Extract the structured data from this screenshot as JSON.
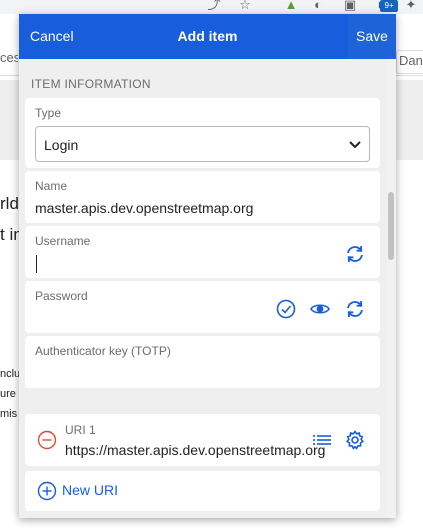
{
  "background_page": {
    "bookmark_left_text": "ces",
    "bookmark_right_text": "Dan",
    "extension_badge": "9+",
    "fragments": [
      "rld",
      "t in",
      "nclu",
      "ure",
      "mis"
    ]
  },
  "header": {
    "cancel_label": "Cancel",
    "title": "Add item",
    "save_label": "Save"
  },
  "section": {
    "title": "ITEM INFORMATION"
  },
  "fields": {
    "type_label": "Type",
    "type_value": "Login",
    "name_label": "Name",
    "name_value": "master.apis.dev.openstreetmap.org",
    "username_label": "Username",
    "username_value": "",
    "password_label": "Password",
    "password_value": "",
    "totp_label": "Authenticator key (TOTP)",
    "totp_value": ""
  },
  "uri": {
    "label": "URI 1",
    "value": "https://master.apis.dev.openstreetmap.org",
    "new_uri_label": "New URI"
  },
  "colors": {
    "accent": "#175ddc",
    "remove": "#dd4b39",
    "label_grey": "#6c6c6c"
  },
  "icons": {
    "username_generate": "refresh-icon",
    "password_check": "check-circle-icon",
    "password_toggle": "eye-icon",
    "password_generate": "refresh-icon",
    "uri_remove": "minus-circle-icon",
    "uri_match": "list-icon",
    "uri_settings": "gear-icon",
    "new_uri": "plus-circle-icon"
  }
}
